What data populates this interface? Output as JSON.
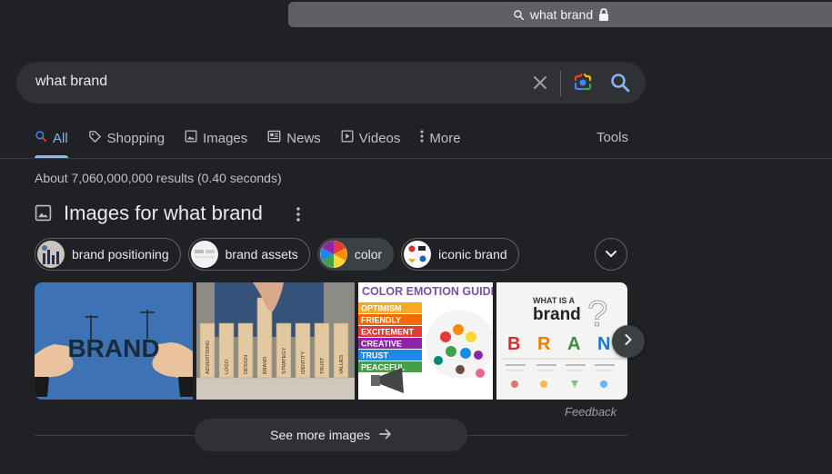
{
  "addressbar": {
    "text": "what brand"
  },
  "search": {
    "query": "what brand"
  },
  "tabs": [
    {
      "label": "All",
      "icon": "search-icon",
      "active": true
    },
    {
      "label": "Shopping",
      "icon": "tag-icon"
    },
    {
      "label": "Images",
      "icon": "image-icon"
    },
    {
      "label": "News",
      "icon": "news-icon"
    },
    {
      "label": "Videos",
      "icon": "play-icon"
    },
    {
      "label": "More",
      "icon": "more-vert-icon"
    }
  ],
  "tools_label": "Tools",
  "result_stats": "About 7,060,000,000 results (0.40 seconds)",
  "images_section": {
    "title": "Images for what brand",
    "chips": [
      {
        "label": "brand positioning",
        "selected": false
      },
      {
        "label": "brand assets",
        "selected": false
      },
      {
        "label": "color",
        "selected": true
      },
      {
        "label": "iconic brand",
        "selected": false
      }
    ],
    "thumbnails": [
      {
        "text": "BRAND"
      },
      {
        "words": [
          "ADVERTISING",
          "LOGO",
          "DESIGN",
          "BRAND",
          "STRATEGY",
          "IDENTITY",
          "TRUST",
          "VALUES"
        ]
      },
      {
        "title": "COLOR EMOTION GUIDE",
        "words": [
          "OPTIMISM",
          "FRIENDLY",
          "EXCITEMENT",
          "CREATIVE",
          "TRUST",
          "PEACEFUL"
        ]
      },
      {
        "line1": "WHAT IS A",
        "line2": "brand",
        "letters": [
          "B",
          "R",
          "A",
          "N"
        ]
      }
    ],
    "feedback": "Feedback",
    "see_more": "See more images"
  }
}
